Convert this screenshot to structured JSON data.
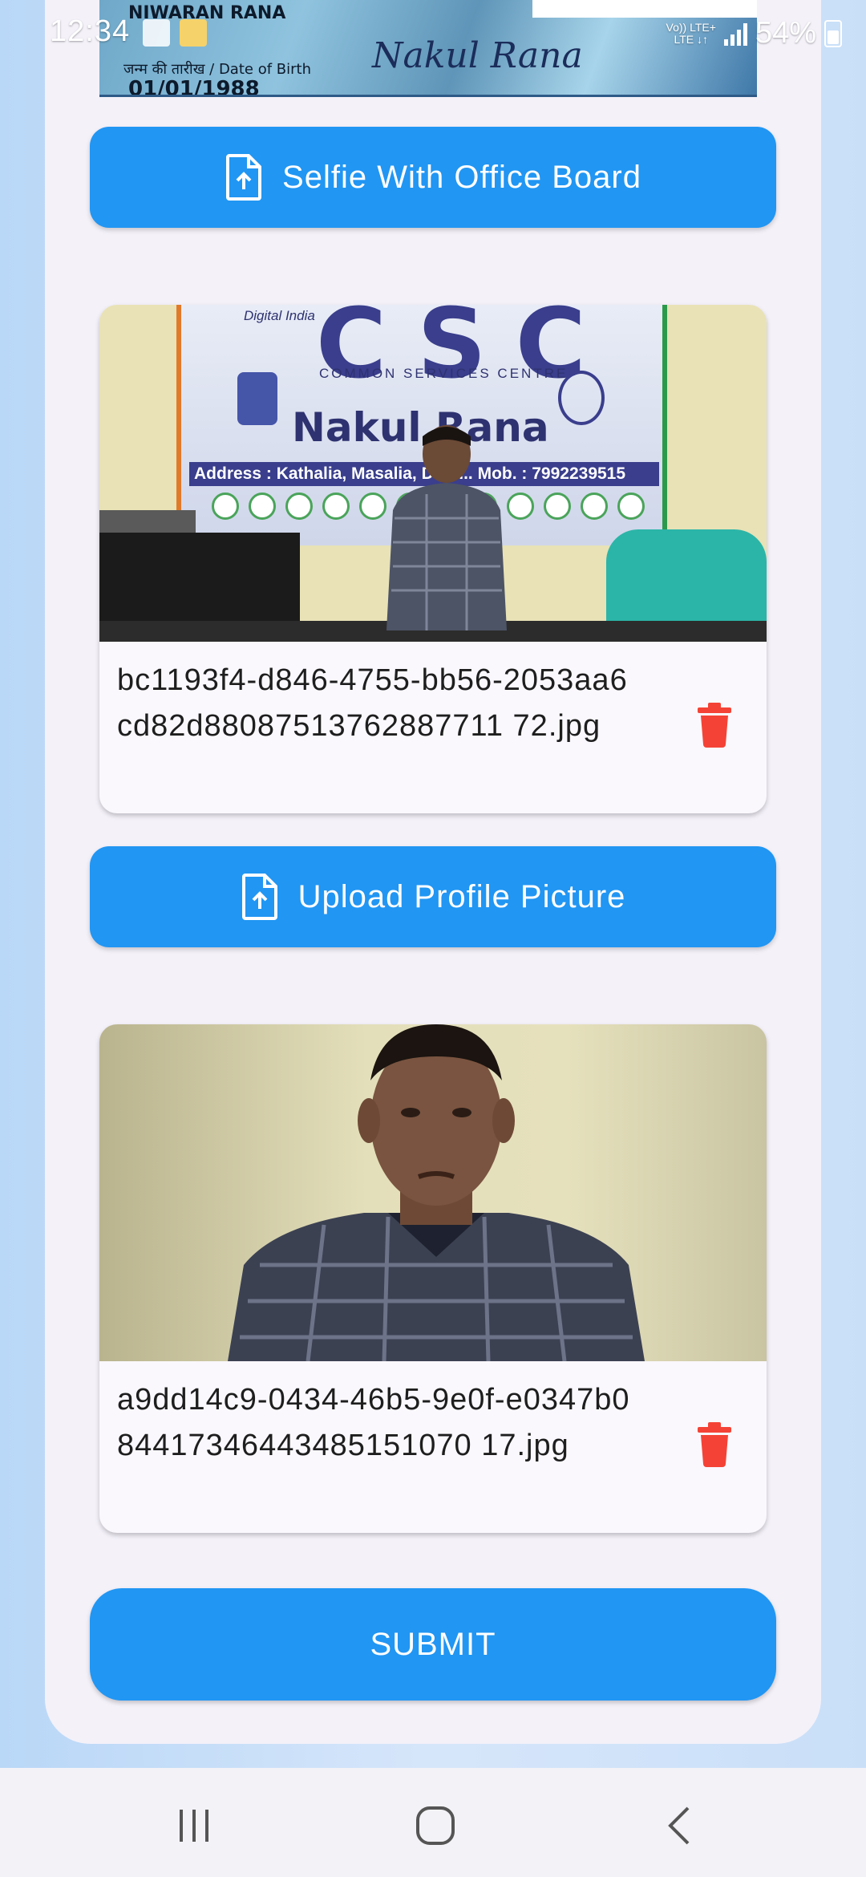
{
  "status_bar": {
    "time": "12:34",
    "network_top": "Vo)) LTE+",
    "network_bottom": "LTE ↓↑",
    "battery": "54%"
  },
  "id_card": {
    "name": "NIWARAN RANA",
    "dob_label": "जन्म की तारीख / Date of Birth",
    "dob": "01/01/1988",
    "signature": "Nakul Rana"
  },
  "selfie_section": {
    "button_label": "Selfie With Office Board",
    "button_icon": "file-upload-icon",
    "photo": {
      "banner_top_left": "Digital India",
      "banner_logo": "CSC",
      "banner_subtitle": "COMMON   SERVICES   CENTRE",
      "banner_name": "Nakul Rana",
      "banner_address": "Address : Kathalia, Masalia, Dum... Mob. : 7992239515"
    },
    "filename": "bc1193f4-d846-4755-bb56-2053aa6cd82d88087513762887711 72.jpg",
    "delete_icon": "trash-icon"
  },
  "profile_section": {
    "button_label": "Upload Profile Picture",
    "button_icon": "file-upload-icon",
    "filename": "a9dd14c9-0434-46b5-9e0f-e0347b084417346443485151070 17.jpg",
    "delete_icon": "trash-icon"
  },
  "submit_label": "SUBMIT",
  "nav": {
    "recents": "recents-icon",
    "home": "home-icon",
    "back": "back-icon"
  },
  "colors": {
    "primary": "#2196f3",
    "delete": "#f44336",
    "card_bg": "#f4f1f9"
  }
}
